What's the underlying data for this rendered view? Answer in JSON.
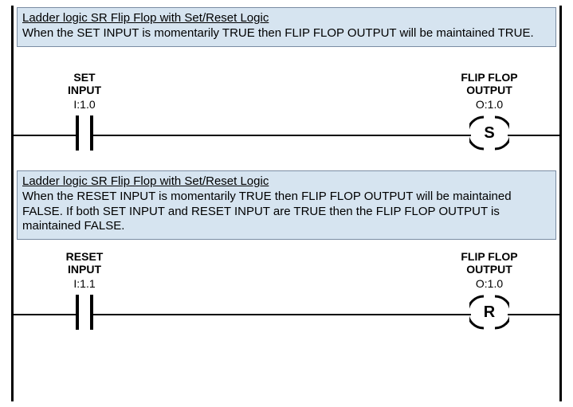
{
  "rungs": [
    {
      "comment_title": "Ladder logic SR Flip Flop with Set/Reset Logic",
      "comment_body": "When the SET INPUT is momentarily TRUE then FLIP FLOP OUTPUT will be maintained TRUE.",
      "contact": {
        "label1": "SET",
        "label2": "INPUT",
        "address": "I:1.0"
      },
      "coil": {
        "label1": "FLIP FLOP",
        "label2": "OUTPUT",
        "address": "O:1.0",
        "type": "S"
      }
    },
    {
      "comment_title": "Ladder logic SR Flip Flop with Set/Reset Logic",
      "comment_body": "When the RESET INPUT is momentarily TRUE then FLIP FLOP OUTPUT will be maintained FALSE. If both SET INPUT and RESET INPUT are TRUE then the FLIP FLOP OUTPUT is maintained FALSE.",
      "contact": {
        "label1": "RESET",
        "label2": "INPUT",
        "address": "I:1.1"
      },
      "coil": {
        "label1": "FLIP FLOP",
        "label2": "OUTPUT",
        "address": "O:1.0",
        "type": "R"
      }
    }
  ]
}
